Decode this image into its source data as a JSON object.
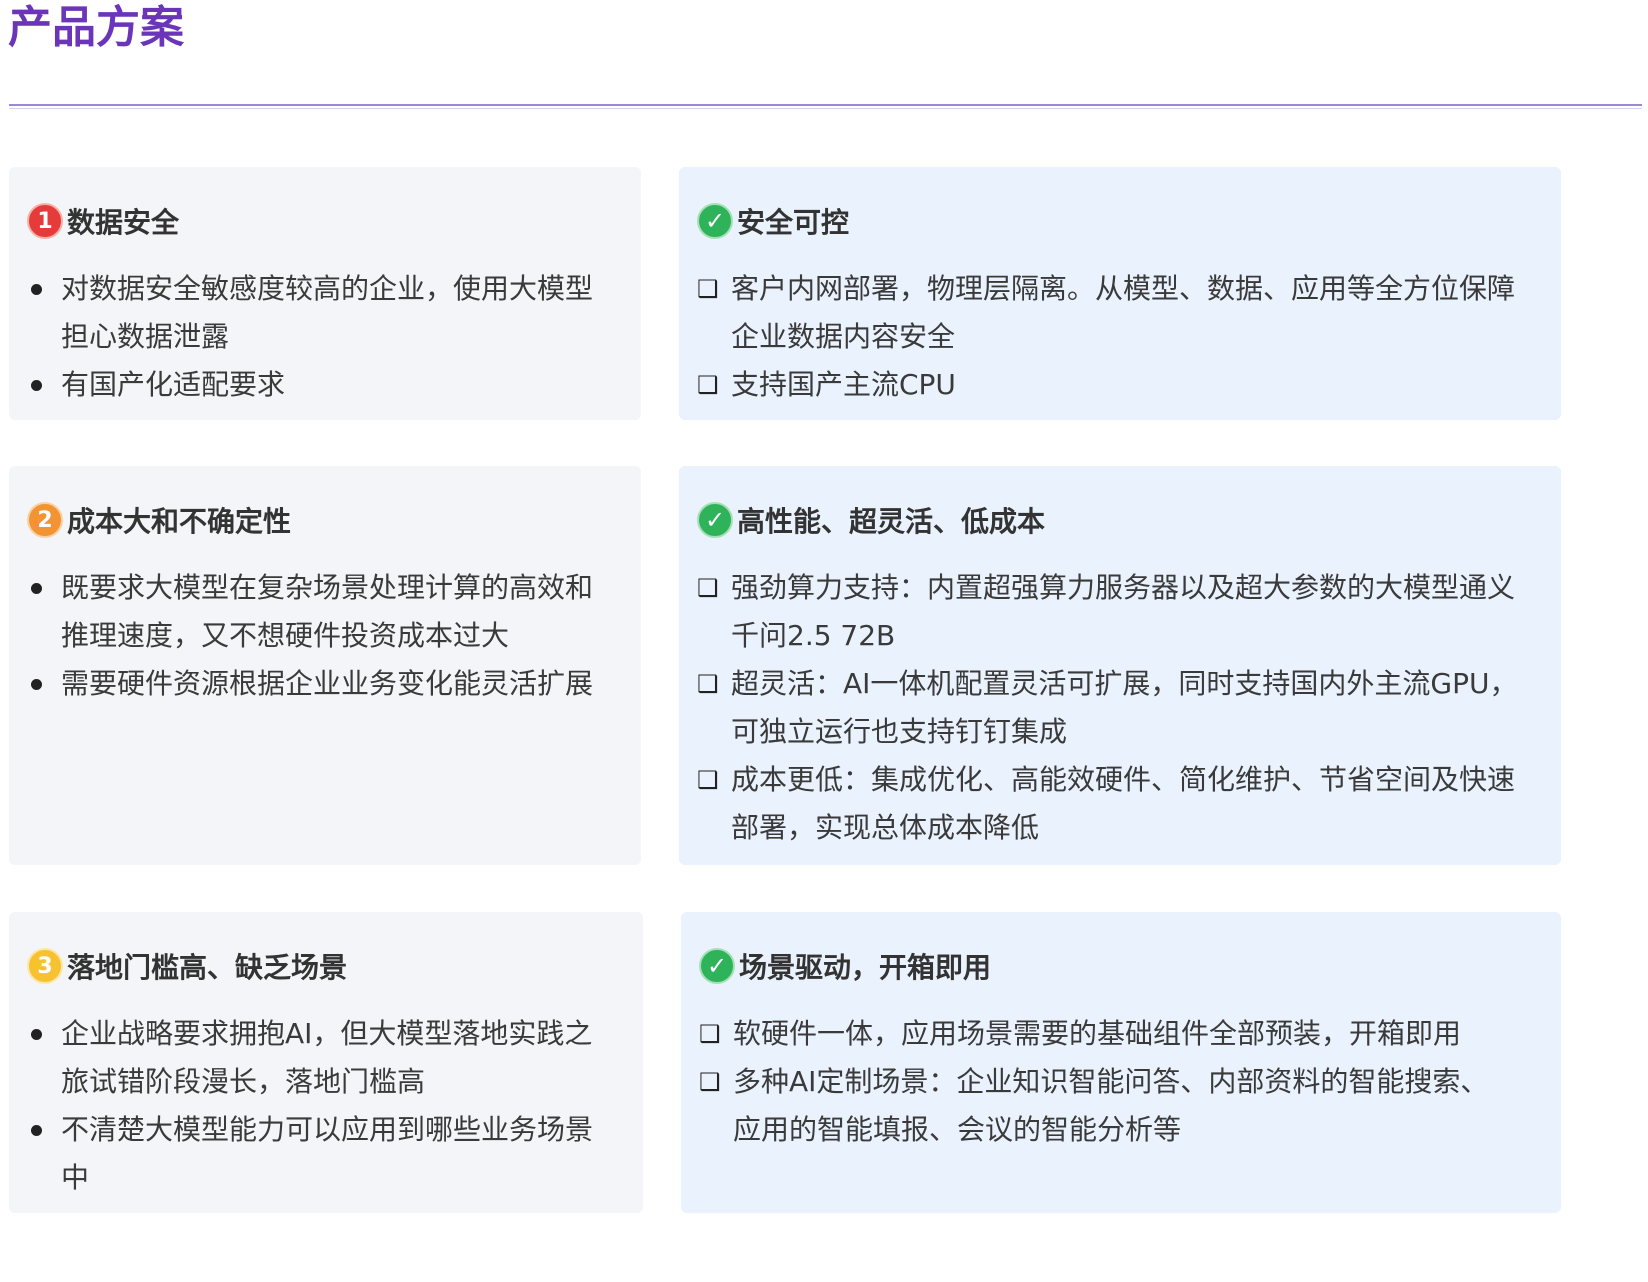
{
  "page_title": "产品方案",
  "rows": [
    {
      "problem": {
        "badge": "1",
        "title": "数据安全",
        "items": [
          "对数据安全敏感度较高的企业，使用大模型担心数据泄露",
          "有国产化适配要求"
        ]
      },
      "solution": {
        "badge": "✓",
        "title": "安全可控",
        "items": [
          "客户内网部署，物理层隔离。从模型、数据、应用等全方位保障企业数据内容安全",
          "支持国产主流CPU"
        ]
      }
    },
    {
      "problem": {
        "badge": "2",
        "title": "成本大和不确定性",
        "items": [
          "既要求大模型在复杂场景处理计算的高效和推理速度，又不想硬件投资成本过大",
          "需要硬件资源根据企业业务变化能灵活扩展"
        ]
      },
      "solution": {
        "badge": "✓",
        "title": "高性能、超灵活、低成本",
        "items": [
          "强劲算力支持：内置超强算力服务器以及超大参数的大模型通义千问2.5 72B",
          "超灵活：AI一体机配置灵活可扩展，同时支持国内外主流GPU，可独立运行也支持钉钉集成",
          "成本更低：集成优化、高能效硬件、简化维护、节省空间及快速部署，实现总体成本降低"
        ]
      }
    },
    {
      "problem": {
        "badge": "3",
        "title": "落地门槛高、缺乏场景",
        "items": [
          "企业战略要求拥抱AI，但大模型落地实践之旅试错阶段漫长，落地门槛高",
          "不清楚大模型能力可以应用到哪些业务场景中"
        ]
      },
      "solution": {
        "badge": "✓",
        "title": "场景驱动，开箱即用",
        "items": [
          "软硬件一体，应用场景需要的基础组件全部预装，开箱即用",
          "多种AI定制场景：企业知识智能问答、内部资料的智能搜索、应用的智能填报、会议的智能分析等"
        ]
      }
    }
  ]
}
